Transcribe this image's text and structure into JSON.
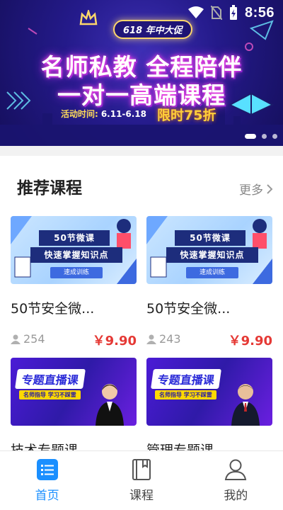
{
  "status_bar": {
    "time": "8:56"
  },
  "banner": {
    "promo_tag": "618 年中大促",
    "headline_1": "名师私教 全程陪伴",
    "headline_2": "一对一高端课程",
    "activity_label": "活动时间:",
    "activity_dates": "6.11-6.18",
    "limited_offer": "限时75折",
    "slides": 3,
    "active_slide": 0
  },
  "section": {
    "title": "推荐课程",
    "more": "更多"
  },
  "courses": [
    {
      "thumb_line1": "50节微课",
      "thumb_line2": "快速掌握知识点",
      "thumb_sub": "速成训练",
      "title": "50节安全微...",
      "enrollment": "254",
      "price": "￥9.90"
    },
    {
      "thumb_line1": "50节微课",
      "thumb_line2": "快速掌握知识点",
      "thumb_sub": "速成训练",
      "title": "50节安全微...",
      "enrollment": "243",
      "price": "￥9.90"
    },
    {
      "thumb_title": "专题直播课",
      "thumb_sub": "名师指导  学习不踩雷",
      "title": "技术专题课"
    },
    {
      "thumb_title": "专题直播课",
      "thumb_sub": "名师指导  学习不踩雷",
      "title": "管理专题课"
    }
  ],
  "tabbar": {
    "tabs": [
      {
        "label": "首页",
        "icon": "home-list-icon",
        "active": true
      },
      {
        "label": "课程",
        "icon": "book-icon",
        "active": false
      },
      {
        "label": "我的",
        "icon": "user-icon",
        "active": false
      }
    ]
  },
  "colors": {
    "accent": "#1a8fff",
    "price": "#e53935",
    "banner_bg": "#241a8a"
  }
}
